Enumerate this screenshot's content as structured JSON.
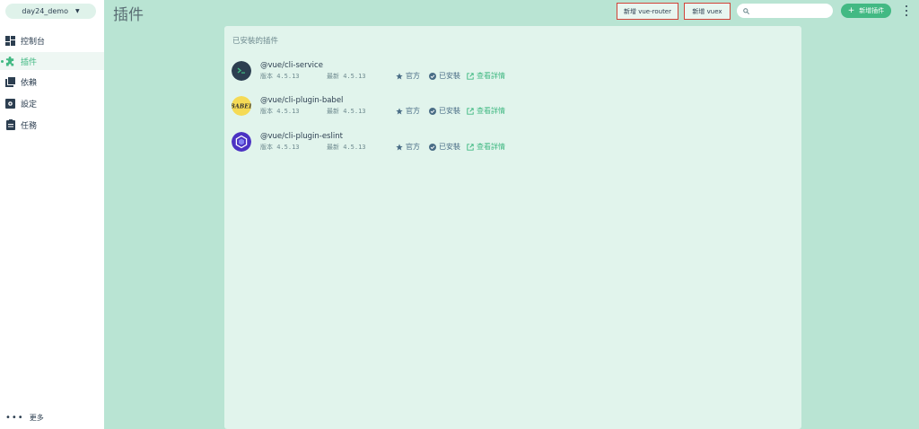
{
  "sidebar": {
    "project": "day24_demo",
    "items": [
      {
        "label": "控制台",
        "icon": "dashboard-icon"
      },
      {
        "label": "插件",
        "icon": "puzzle-icon"
      },
      {
        "label": "依賴",
        "icon": "library-icon"
      },
      {
        "label": "設定",
        "icon": "settings-icon"
      },
      {
        "label": "任務",
        "icon": "clipboard-icon"
      }
    ],
    "active": "插件",
    "more": "更多"
  },
  "header": {
    "title": "插件",
    "add_router": "新增 vue-router",
    "add_vuex": "新增 vuex",
    "search_placeholder": "",
    "add_plugin": "新增插件"
  },
  "main": {
    "section_title": "已安裝的插件",
    "plugins": [
      {
        "name": "@vue/cli-service",
        "version_label": "版本 4.5.13",
        "latest_label": "最新 4.5.13",
        "official": "官方",
        "installed": "已安裝",
        "details": "查看詳情",
        "logo": "cli-service-logo"
      },
      {
        "name": "@vue/cli-plugin-babel",
        "version_label": "版本 4.5.13",
        "latest_label": "最新 4.5.13",
        "official": "官方",
        "installed": "已安裝",
        "details": "查看詳情",
        "logo": "babel-logo"
      },
      {
        "name": "@vue/cli-plugin-eslint",
        "version_label": "版本 4.5.13",
        "latest_label": "最新 4.5.13",
        "official": "官方",
        "installed": "已安裝",
        "details": "查看詳情",
        "logo": "eslint-logo"
      }
    ]
  },
  "colors": {
    "accent": "#42b983",
    "background": "#b9e4d3",
    "card": "#e1f4ec",
    "highlight_border": "#d14338"
  }
}
